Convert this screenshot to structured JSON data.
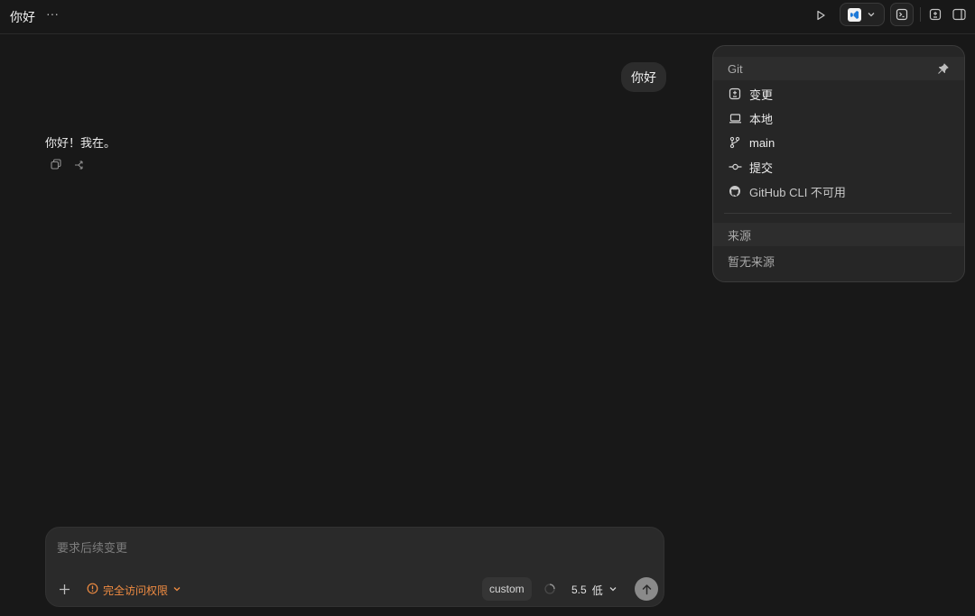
{
  "header": {
    "title": "你好",
    "more_icon": "ellipsis-icon",
    "play_icon": "play-icon",
    "editor_icon": "vscode-icon",
    "terminal_icon": "terminal-icon",
    "panel_icons": [
      "diff-panel-icon",
      "sidebar-right-icon"
    ]
  },
  "chat": {
    "user_message": "你好",
    "assistant_message": "你好！我在。",
    "actions": [
      "copy-icon",
      "fork-icon"
    ]
  },
  "git": {
    "header": "Git",
    "items": [
      {
        "icon": "diff-icon",
        "label": "变更"
      },
      {
        "icon": "laptop-icon",
        "label": "本地"
      },
      {
        "icon": "branch-icon",
        "label": "main"
      },
      {
        "icon": "commit-icon",
        "label": "提交"
      },
      {
        "icon": "github-icon",
        "label": "GitHub CLI 不可用"
      }
    ],
    "sources_header": "来源",
    "sources_empty": "暂无来源"
  },
  "composer": {
    "placeholder": "要求后续变更",
    "access_label": "完全访问权限",
    "model": "custom",
    "version": "5.5",
    "effort": "低"
  },
  "colors": {
    "background": "#181818",
    "panel": "#262626",
    "accent_orange": "#f08c42",
    "send_button": "#8a8a8a"
  }
}
